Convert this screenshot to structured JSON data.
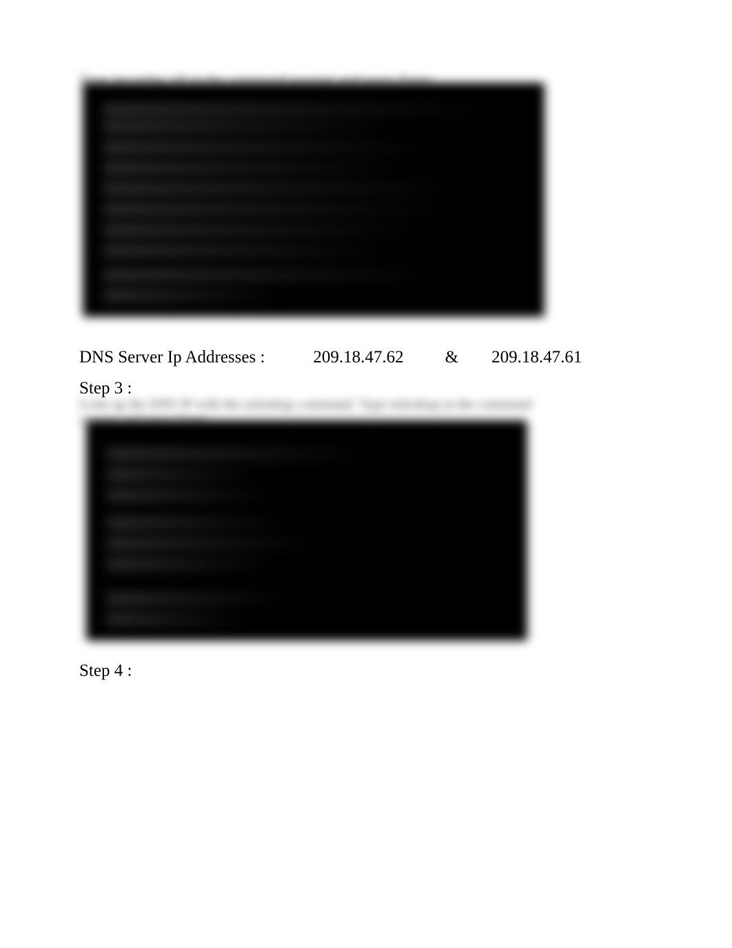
{
  "blur_caption_1": "Type ipconfig /all at the command prompt and press Enter",
  "blur_caption_2": "Look up the DNS IP with the nslookup command. Type nslookup at the command prompt and press Enter.",
  "dns": {
    "label": "DNS Server Ip Addresses :",
    "ip1": "209.18.47.62",
    "amp": "&",
    "ip2": "209.18.47.61"
  },
  "steps": {
    "step3": "Step 3 :",
    "step4": "Step 4 :"
  }
}
